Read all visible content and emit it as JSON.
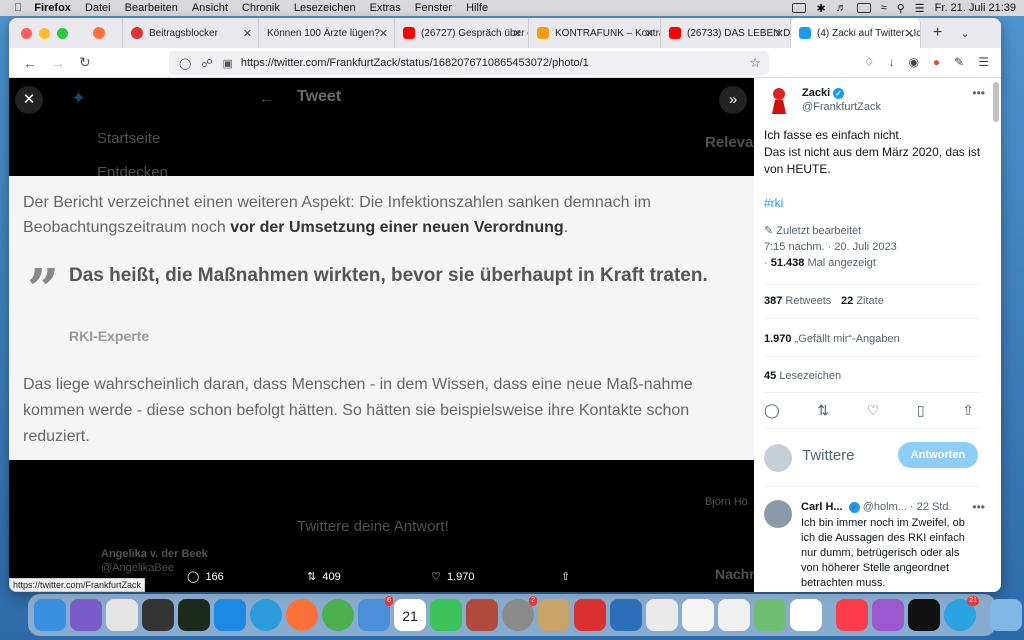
{
  "menubar": {
    "app": "Firefox",
    "items": [
      "Datei",
      "Bearbeiten",
      "Ansicht",
      "Chronik",
      "Lesezeichen",
      "Extras",
      "Fenster",
      "Hilfe"
    ],
    "clock": "Fr. 21. Juli  21:39"
  },
  "tabs": [
    {
      "label": "",
      "icon": "firefox-icon"
    },
    {
      "label": "Beitragsblocker",
      "icon": "block-icon"
    },
    {
      "label": "Können 100 Ärzte lügen?",
      "icon": "page-icon"
    },
    {
      "label": "(26727) Gespräch über e",
      "icon": "youtube-icon"
    },
    {
      "label": "KONTRAFUNK – Kontrafu",
      "icon": "kontrafunk-icon"
    },
    {
      "label": "(26733) DAS LEBEN DER",
      "icon": "youtube-icon"
    },
    {
      "label": "(4) Zacki auf Twitter: „Ic",
      "icon": "twitter-icon"
    }
  ],
  "url": "https://twitter.com/FrankfurtZack/status/1682076710865453072/photo/1",
  "background_page": {
    "tweet_header": "Tweet",
    "home": "Startseite",
    "explore": "Entdecken",
    "relevant": "Releva",
    "reply_placeholder": "Twittere deine Antwort!",
    "reply_user": "Angelika v. der Beek",
    "reply_handle": "@AngelikaBee",
    "side_names": [
      "Björn Hö",
      "Nachr"
    ]
  },
  "image": {
    "paragraph1_pre": "Der Bericht verzeichnet einen weiteren Aspekt: Die Infektionszahlen sanken demnach im Beobachtungszeitraum noch ",
    "paragraph1_bold": "vor der Umsetzung einer neuen Verordnung",
    "paragraph1_post": ".",
    "quote": "Das heißt, die Maßnahmen wirkten, bevor sie überhaupt in Kraft traten.",
    "quote_source": "RKI-Experte",
    "paragraph2": "Das liege wahrscheinlich daran, dass Menschen - in dem Wissen, dass eine neue Maß-nahme kommen werde - diese schon befolgt hätten. So hätten sie beispielsweise ihre Kontakte schon reduziert."
  },
  "photo_actions": {
    "replies": "166",
    "retweets": "409",
    "likes": "1.970"
  },
  "status_url": "https://twitter.com/FrankfurtZack",
  "tweet": {
    "name": "Zacki",
    "handle": "@FrankfurtZack",
    "text": "Ich fasse es einfach nicht.\nDas ist nicht aus dem März 2020, das ist von HEUTE.",
    "hashtag": "#rki",
    "edited": "Zuletzt bearbeitet",
    "time": "7:15 nachm. · 20. Juli 2023",
    "views_count": "51.438",
    "views_label": "Mal angezeigt",
    "retweets_count": "387",
    "retweets_label": "Retweets",
    "quotes_count": "22",
    "quotes_label": "Zitate",
    "likes_count": "1.970",
    "likes_label": "„Gefällt mir“-Angaben",
    "bookmarks_count": "45",
    "bookmarks_label": "Lesezeichen"
  },
  "reply_box": {
    "placeholder": "Twittere",
    "button": "Antworten"
  },
  "comment": {
    "name": "Carl H...",
    "meta": "@holm... · 22 Std.",
    "text": "Ich bin immer noch im Zweifel, ob ich die Aussagen des RKI einfach nur dumm, betrügerisch oder als von höherer Stelle angeordnet betrachten muss."
  },
  "dock_badges": {
    "mail": "6",
    "calendar_day": "21",
    "settings": "2",
    "telegram": "21"
  },
  "colors": {
    "accent": "#1d9bf0",
    "reply_button": "#8ecdf8"
  }
}
